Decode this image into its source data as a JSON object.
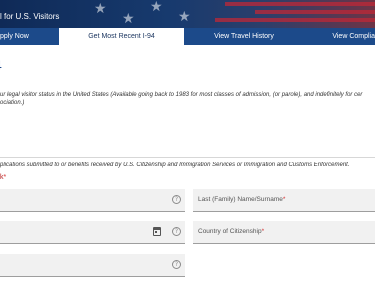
{
  "banner": {
    "text": "l for U.S. Visitors"
  },
  "nav": {
    "items": [
      {
        "label": "pply Now"
      },
      {
        "label": "Get Most Recent I-94"
      },
      {
        "label": "View Travel History"
      },
      {
        "label": "View Complia"
      }
    ],
    "active_index": 1
  },
  "page": {
    "title": "4",
    "intro_line1": "ur legal visitor status in the United States (Available going back to 1983 for most classes of admission, (or parole), and indefinitely for cer",
    "intro_line2": "ociation.)",
    "warning": "plications submitted to or benefits received by U.S. Citizenship and Immigration Services or Immigration and Customs Enforcement.",
    "required_label": "k",
    "required_marker": "*"
  },
  "form": {
    "first_name_field": {
      "label": ""
    },
    "last_name_field": {
      "label": "Last (Family) Name/Surname",
      "required": "*"
    },
    "birth_date_field": {
      "label": ""
    },
    "country_field": {
      "label": "Country of Citizenship",
      "required": "*"
    },
    "document_field": {
      "label": ""
    }
  },
  "icons": {
    "help": "help-icon",
    "calendar": "calendar-icon"
  },
  "colors": {
    "nav_bg": "#1c4a8a",
    "title": "#1c4a8a",
    "required": "#d32f2f",
    "field_bg": "#f1f1f1"
  }
}
